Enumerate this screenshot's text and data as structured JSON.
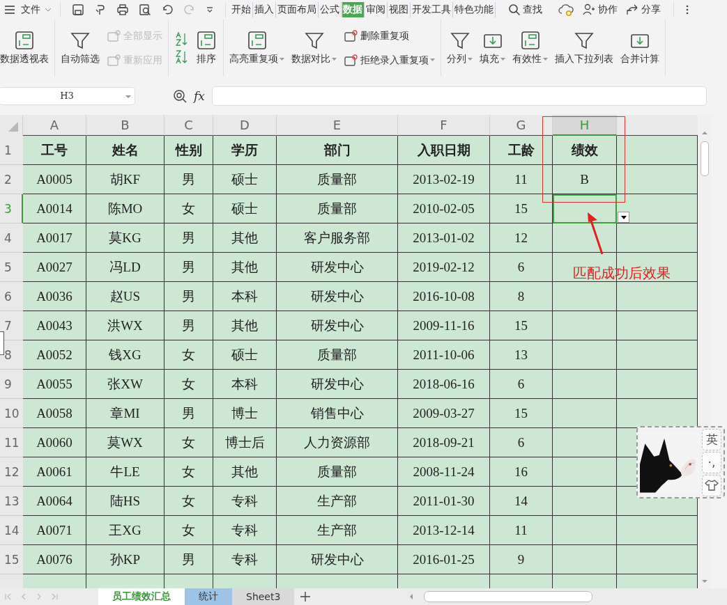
{
  "menu_bar": {
    "file_label": "文件",
    "tabs": [
      {
        "label": "开始",
        "selected": false
      },
      {
        "label": "插入",
        "selected": false
      },
      {
        "label": "页面布局",
        "selected": false
      },
      {
        "label": "公式",
        "selected": false
      },
      {
        "label": "数据",
        "selected": true
      },
      {
        "label": "审阅",
        "selected": false
      },
      {
        "label": "视图",
        "selected": false
      },
      {
        "label": "开发工具",
        "selected": false
      },
      {
        "label": "特色功能",
        "selected": false
      }
    ],
    "search_label": "查找",
    "collaborate_label": "协作",
    "share_label": "分享"
  },
  "ribbon": {
    "groups": [
      {
        "items": [
          {
            "kind": "large",
            "label": "数据透视表",
            "disabled": false,
            "dropdown": false
          }
        ]
      },
      {
        "items": [
          {
            "kind": "large",
            "label": "自动筛选",
            "disabled": false,
            "dropdown": false
          },
          {
            "kind": "stack",
            "items": [
              {
                "label": "全部显示",
                "disabled": true,
                "dropdown": false
              },
              {
                "label": "重新应用",
                "disabled": true,
                "dropdown": false
              }
            ]
          }
        ]
      },
      {
        "items": [
          {
            "kind": "sort-icons"
          },
          {
            "kind": "large",
            "label": "排序",
            "disabled": false,
            "dropdown": false
          }
        ]
      },
      {
        "items": [
          {
            "kind": "large",
            "label": "高亮重复项",
            "disabled": false,
            "dropdown": true
          },
          {
            "kind": "large",
            "label": "数据对比",
            "disabled": false,
            "dropdown": true
          },
          {
            "kind": "stack",
            "items": [
              {
                "label": "删除重复项",
                "disabled": false,
                "dropdown": false
              },
              {
                "label": "拒绝录入重复项",
                "disabled": false,
                "dropdown": true
              }
            ]
          }
        ]
      },
      {
        "items": [
          {
            "kind": "large",
            "label": "分列",
            "disabled": false,
            "dropdown": true
          },
          {
            "kind": "large",
            "label": "填充",
            "disabled": false,
            "dropdown": true
          },
          {
            "kind": "large",
            "label": "有效性",
            "disabled": false,
            "dropdown": true
          },
          {
            "kind": "large",
            "label": "插入下拉列表",
            "disabled": false,
            "dropdown": false
          },
          {
            "kind": "large",
            "label": "合并计算",
            "disabled": false,
            "dropdown": false
          }
        ]
      }
    ]
  },
  "formula_bar": {
    "name_box": "H3",
    "fx_label": "fx"
  },
  "sheet": {
    "columns": [
      {
        "label": "A",
        "selected": false
      },
      {
        "label": "B",
        "selected": false
      },
      {
        "label": "C",
        "selected": false
      },
      {
        "label": "D",
        "selected": false
      },
      {
        "label": "E",
        "selected": false
      },
      {
        "label": "F",
        "selected": false
      },
      {
        "label": "G",
        "selected": false
      },
      {
        "label": "H",
        "selected": true
      }
    ],
    "rows": [
      {
        "number": "1",
        "selected": false,
        "cells": [
          "工号",
          "姓名",
          "性别",
          "学历",
          "部门",
          "入职日期",
          "工龄",
          "绩效"
        ]
      },
      {
        "number": "2",
        "selected": false,
        "cells": [
          "A0005",
          "胡KF",
          "男",
          "硕士",
          "质量部",
          "2013-02-19",
          "11",
          "B"
        ]
      },
      {
        "number": "3",
        "selected": true,
        "cells": [
          "A0014",
          "陈MO",
          "女",
          "硕士",
          "质量部",
          "2010-02-05",
          "15",
          ""
        ]
      },
      {
        "number": "4",
        "selected": false,
        "cells": [
          "A0017",
          "莫KG",
          "男",
          "其他",
          "客户服务部",
          "2013-01-02",
          "12",
          ""
        ]
      },
      {
        "number": "5",
        "selected": false,
        "cells": [
          "A0027",
          "冯LD",
          "男",
          "其他",
          "研发中心",
          "2019-02-12",
          "6",
          ""
        ]
      },
      {
        "number": "6",
        "selected": false,
        "cells": [
          "A0036",
          "赵US",
          "男",
          "本科",
          "研发中心",
          "2016-10-08",
          "8",
          ""
        ]
      },
      {
        "number": "7",
        "selected": false,
        "cells": [
          "A0043",
          "洪WX",
          "男",
          "其他",
          "研发中心",
          "2009-11-16",
          "15",
          ""
        ]
      },
      {
        "number": "8",
        "selected": false,
        "cells": [
          "A0052",
          "钱XG",
          "女",
          "硕士",
          "质量部",
          "2011-10-06",
          "13",
          ""
        ]
      },
      {
        "number": "9",
        "selected": false,
        "cells": [
          "A0055",
          "张XW",
          "女",
          "本科",
          "研发中心",
          "2018-06-16",
          "6",
          ""
        ]
      },
      {
        "number": "10",
        "selected": false,
        "cells": [
          "A0058",
          "章MI",
          "男",
          "博士",
          "销售中心",
          "2009-03-27",
          "15",
          ""
        ]
      },
      {
        "number": "11",
        "selected": false,
        "cells": [
          "A0060",
          "莫WX",
          "女",
          "博士后",
          "人力资源部",
          "2018-09-21",
          "6",
          ""
        ]
      },
      {
        "number": "12",
        "selected": false,
        "cells": [
          "A0061",
          "牛LE",
          "女",
          "其他",
          "质量部",
          "2008-11-24",
          "16",
          ""
        ]
      },
      {
        "number": "13",
        "selected": false,
        "cells": [
          "A0064",
          "陆HS",
          "女",
          "专科",
          "生产部",
          "2011-01-30",
          "14",
          ""
        ]
      },
      {
        "number": "14",
        "selected": false,
        "cells": [
          "A0071",
          "王XG",
          "女",
          "专科",
          "生产部",
          "2013-12-14",
          "11",
          ""
        ]
      },
      {
        "number": "15",
        "selected": false,
        "cells": [
          "A0076",
          "孙KP",
          "男",
          "专科",
          "研发中心",
          "2016-01-25",
          "9",
          ""
        ]
      }
    ]
  },
  "annotation": {
    "text": "匹配成功后效果"
  },
  "ime_widget": {
    "kind": "picture",
    "language_label": "英",
    "punctuation_label": "·,"
  },
  "sheet_tabs": [
    {
      "label": "员工绩效汇总",
      "selected": true,
      "color": "#ffffff"
    },
    {
      "label": "统计",
      "selected": false,
      "color": "#9dc3e6"
    },
    {
      "label": "Sheet3",
      "selected": false,
      "color": "#d9d9d9"
    }
  ]
}
